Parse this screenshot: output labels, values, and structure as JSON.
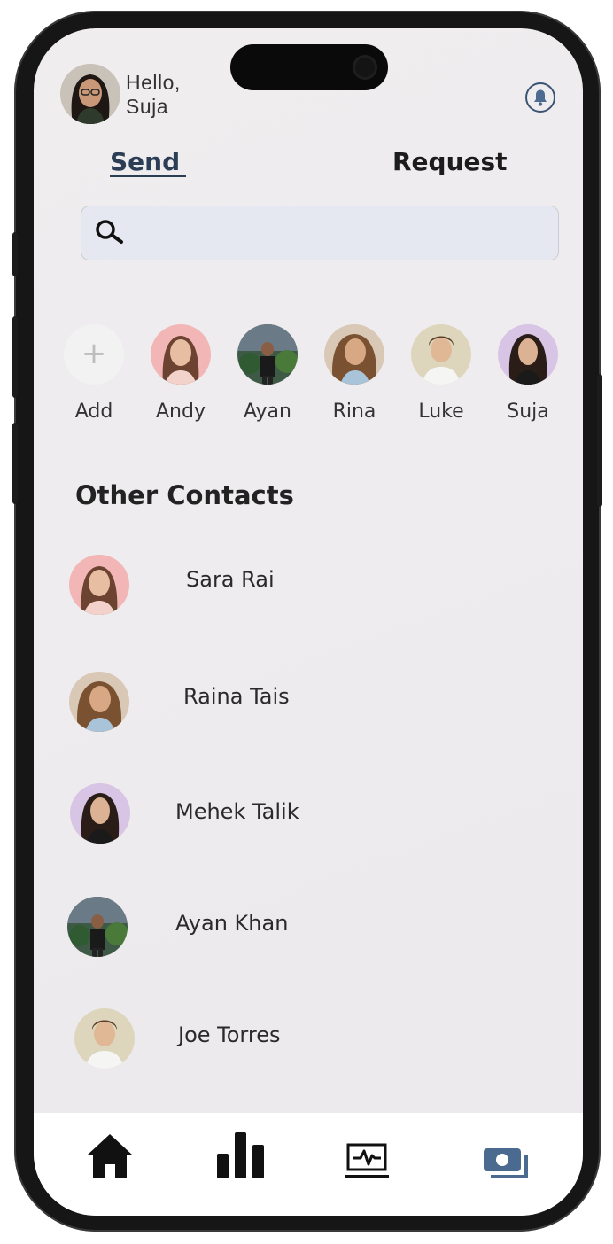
{
  "greeting": {
    "line1": "Hello,",
    "line2": "Suja"
  },
  "tabs": {
    "send": "Send",
    "request": "Request"
  },
  "search": {
    "placeholder": ""
  },
  "quick_contacts": [
    {
      "label": "Add"
    },
    {
      "label": "Andy"
    },
    {
      "label": "Ayan"
    },
    {
      "label": "Rina"
    },
    {
      "label": "Luke"
    },
    {
      "label": "Suja"
    }
  ],
  "section_title": "Other Contacts",
  "contacts": [
    {
      "name": "Sara Rai"
    },
    {
      "name": "Raina Tais"
    },
    {
      "name": "Mehek Talik"
    },
    {
      "name": "Ayan Khan"
    },
    {
      "name": "Joe Torres"
    }
  ],
  "icons": {
    "bell": "bell-icon",
    "search": "search-icon",
    "add": "plus-icon",
    "home": "home-icon",
    "stats": "bar-chart-icon",
    "activity": "monitor-activity-icon",
    "payments": "money-icon"
  },
  "colors": {
    "accent": "#2c3e55",
    "active_tab_icon": "#4a6a8f",
    "search_bg": "#e5e8f0"
  }
}
